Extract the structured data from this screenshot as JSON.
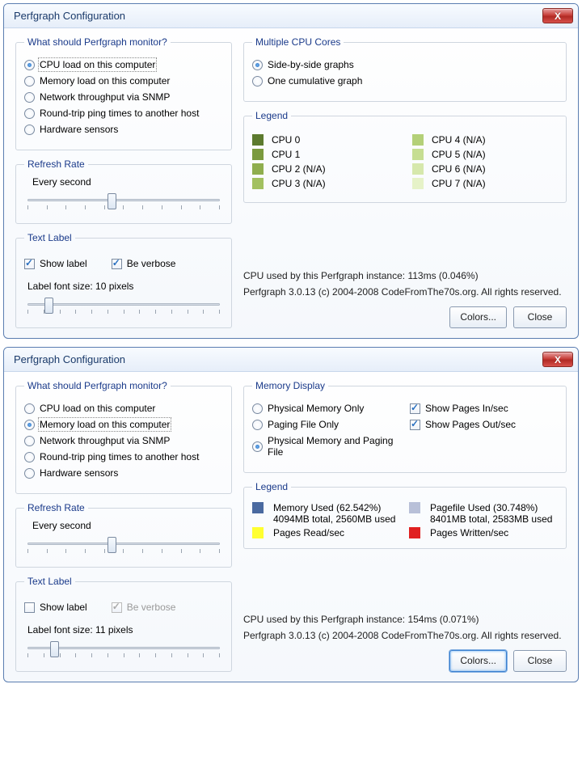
{
  "window_title": "Perfgraph Configuration",
  "close_glyph": "X",
  "monitor": {
    "legend": "What should Perfgraph monitor?",
    "opts": {
      "cpu": "CPU load on this computer",
      "mem": "Memory load on this computer",
      "net": "Network throughput via SNMP",
      "ping": "Round-trip ping times to another host",
      "hw": "Hardware sensors"
    }
  },
  "refresh": {
    "legend": "Refresh Rate",
    "label": "Every second"
  },
  "textlabel": {
    "legend": "Text Label",
    "show": "Show label",
    "verbose": "Be verbose",
    "fontA": "Label font size: 10 pixels",
    "fontB": "Label font size: 11 pixels"
  },
  "cpucores": {
    "legend": "Multiple CPU Cores",
    "side": "Side-by-side graphs",
    "cumul": "One cumulative graph"
  },
  "legend_label": "Legend",
  "cpu_left": [
    {
      "label": "CPU 0",
      "color": "#5c7a2e"
    },
    {
      "label": "CPU 1",
      "color": "#7a9a3e"
    },
    {
      "label": "CPU 2 (N/A)",
      "color": "#8fae4e"
    },
    {
      "label": "CPU 3 (N/A)",
      "color": "#a2c060"
    }
  ],
  "cpu_right": [
    {
      "label": "CPU 4 (N/A)",
      "color": "#b4d078"
    },
    {
      "label": "CPU 5 (N/A)",
      "color": "#c6de92"
    },
    {
      "label": "CPU 6 (N/A)",
      "color": "#d6e8ac"
    },
    {
      "label": "CPU 7 (N/A)",
      "color": "#e6f2c8"
    }
  ],
  "memdisplay": {
    "legend": "Memory Display",
    "phys": "Physical Memory Only",
    "page": "Paging File Only",
    "both": "Physical Memory and Paging File",
    "pin": "Show Pages In/sec",
    "pout": "Show Pages Out/sec"
  },
  "memlegend": {
    "mu_label": "Memory Used (62.542%)",
    "mu_sub": "4094MB total, 2560MB used",
    "pf_label": "Pagefile Used (30.748%)",
    "pf_sub": "8401MB total, 2583MB used",
    "pr": "Pages Read/sec",
    "pw": "Pages Written/sec",
    "c_mu": "#4a6aa0",
    "c_pf": "#b8c0d8",
    "c_pr": "#ffff30",
    "c_pw": "#e02020"
  },
  "statusA": {
    "cpu": "CPU used by this Perfgraph instance: 113ms (0.046%)",
    "ver": "Perfgraph 3.0.13 (c) 2004-2008 CodeFromThe70s.org. All rights reserved."
  },
  "statusB": {
    "cpu": "CPU used by this Perfgraph instance: 154ms (0.071%)",
    "ver": "Perfgraph 3.0.13 (c) 2004-2008 CodeFromThe70s.org. All rights reserved."
  },
  "buttons": {
    "colors": "Colors...",
    "close": "Close"
  }
}
